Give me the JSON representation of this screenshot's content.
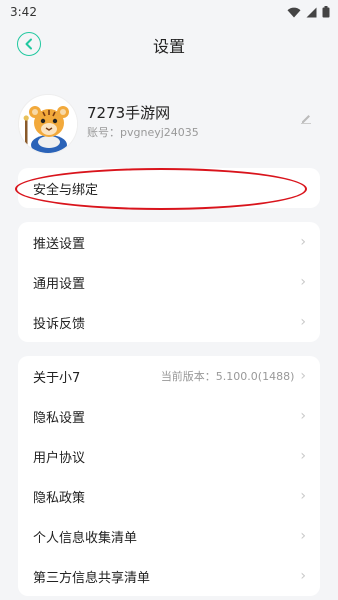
{
  "status_bar": {
    "time": "3:42",
    "icons": [
      "wifi-icon",
      "signal-icon",
      "battery-icon"
    ]
  },
  "nav": {
    "title": "设置",
    "back_icon": "back-arrow-icon"
  },
  "profile": {
    "name": "7273手游网",
    "account": "账号：pvgneyj24035",
    "avatar": "tiger-avatar",
    "edit_icon": "edit-pencil-icon"
  },
  "security_row": {
    "label": "安全与绑定"
  },
  "group_one": [
    {
      "label": "推送设置"
    },
    {
      "label": "通用设置"
    },
    {
      "label": "投诉反馈"
    }
  ],
  "group_two": [
    {
      "label": "关于小7",
      "value": "当前版本：5.100.0(1488)"
    },
    {
      "label": "隐私设置"
    },
    {
      "label": "用户协议"
    },
    {
      "label": "隐私政策"
    },
    {
      "label": "个人信息收集清单"
    },
    {
      "label": "第三方信息共享清单"
    }
  ],
  "colors": {
    "accent": "#21c8a0",
    "annotation": "#d9141c",
    "background": "#f4f5f7",
    "card": "#ffffff"
  }
}
